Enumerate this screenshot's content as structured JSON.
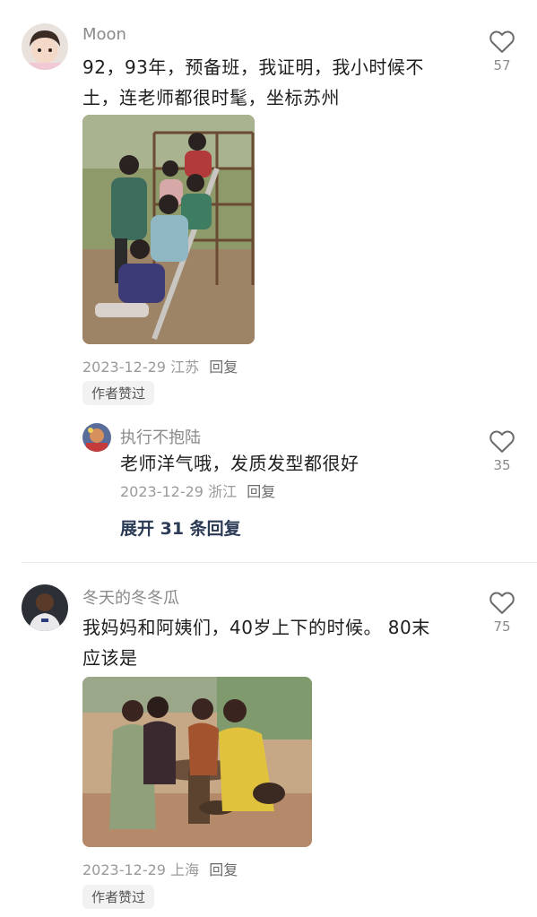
{
  "comments": [
    {
      "username": "Moon",
      "text_line1": "92，93年，预备班，我证明，我小时候不",
      "text_line2": "土，连老师都很时髦，坐标苏州",
      "date": "2023-12-29",
      "location": "江苏",
      "reply_label": "回复",
      "badge": "作者赞过",
      "likes": "57",
      "sub_reply": {
        "username": "执行不抱陆",
        "text": "老师洋气哦，发质发型都很好",
        "date": "2023-12-29",
        "location": "浙江",
        "reply_label": "回复",
        "likes": "35"
      },
      "expand_label": "展开 31 条回复"
    },
    {
      "username": "冬天的冬冬瓜",
      "text_line1": "我妈妈和阿姨们，40岁上下的时候。 80末",
      "text_line2": "应该是",
      "date": "2023-12-29",
      "location": "上海",
      "reply_label": "回复",
      "badge": "作者赞过",
      "likes": "75"
    }
  ],
  "colors": {
    "accent": "#2b3a55",
    "muted": "#9a9a9a"
  },
  "icons": {
    "like": "heart-outline-icon"
  }
}
